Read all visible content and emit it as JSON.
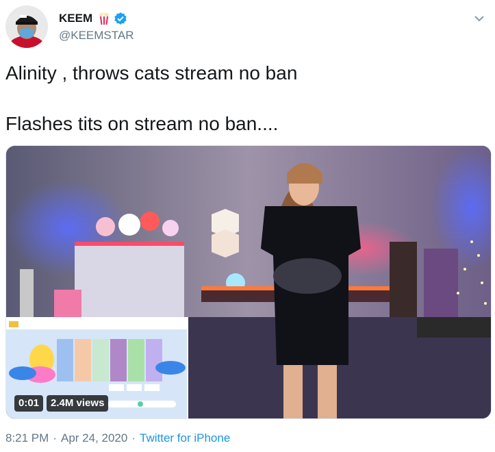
{
  "tweet": {
    "display_name": "KEEM",
    "handle": "@KEEMSTAR",
    "text_line1": "Alinity , throws cats stream no ban",
    "text_line2": "Flashes tits on stream no ban....",
    "name_emoji_icon": "popcorn-icon",
    "verified_icon": "verified-badge-icon",
    "menu_icon": "chevron-down-icon"
  },
  "video": {
    "elapsed": "0:01",
    "views": "2.4M views"
  },
  "meta": {
    "time": "8:21 PM",
    "date": "Apr 24, 2020",
    "source": "Twitter for iPhone",
    "separator": "·"
  },
  "colors": {
    "link": "#1b95e0",
    "secondary_text": "#657786",
    "verified": "#1da1f2"
  }
}
